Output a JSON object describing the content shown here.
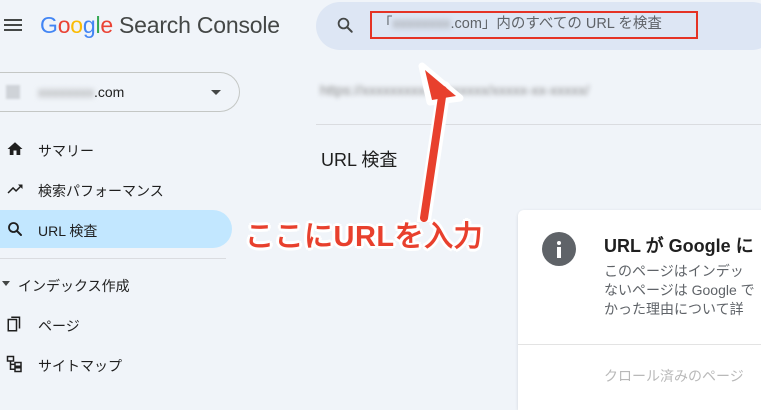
{
  "app": {
    "logo_letters": [
      "G",
      "o",
      "o",
      "g",
      "l",
      "e"
    ],
    "product_name": "Search Console"
  },
  "search": {
    "prefix": "「",
    "domain_blurred": "xxxxxxxx",
    "suffix": ".com」内のすべての URL を検査"
  },
  "property": {
    "name_blurred": "xxxxxxxx",
    "name_suffix": ".com"
  },
  "sidebar": {
    "items": [
      {
        "label": "サマリー",
        "icon": "home-icon"
      },
      {
        "label": "検索パフォーマンス",
        "icon": "trending-up-icon"
      },
      {
        "label": "URL 検査",
        "icon": "search-icon",
        "active": true
      }
    ],
    "section": "インデックス作成",
    "section_items": [
      {
        "label": "ページ",
        "icon": "pages-icon"
      },
      {
        "label": "サイトマップ",
        "icon": "sitemap-icon"
      }
    ]
  },
  "main": {
    "url_blurred": "https://xxxxxxxxxxxxxxxxxx/xxxxx-xx-xxxxx/",
    "title": "URL 検査",
    "card": {
      "title": "URL が Google に",
      "description": "このページはインデッ\nないページは Google で\nかった理由について詳",
      "footer": "クロール済みのページ"
    }
  },
  "annotation": {
    "text": "ここにURLを入力",
    "color": "#e8402d"
  },
  "colors": {
    "background": "#f0f4f9",
    "active_nav": "#c2e7ff",
    "search_box": "#dde6f4",
    "highlight_border": "#e53325"
  }
}
